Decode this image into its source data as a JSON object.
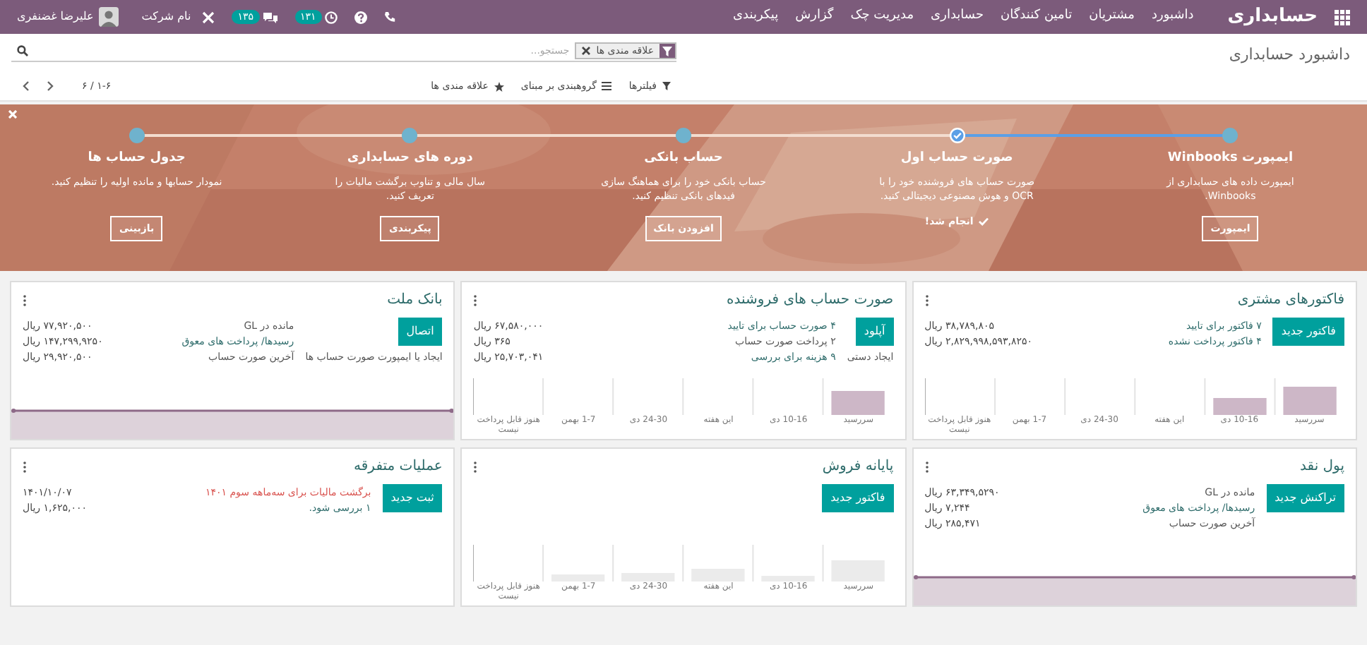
{
  "navbar": {
    "app_title": "حسابداری",
    "menu": [
      "داشبورد",
      "مشتریان",
      "تامین کنندگان",
      "حسابداری",
      "مدیریت چک",
      "گزارش",
      "پیکربندی"
    ],
    "activity_count": "۱۳۱",
    "message_count": "۱۳۵",
    "company": "نام شرکت",
    "user": "علیرضا غضنفری"
  },
  "control_panel": {
    "breadcrumb": "داشبورد حسابداری",
    "search": {
      "facet": "علاقه مندی ها",
      "placeholder": "جستجو..."
    },
    "filters": "فیلترها",
    "group_by": "گروهبندی بر مبنای",
    "favorites": "علاقه مندی ها",
    "pager": "۱-۶ / ۶"
  },
  "onboarding": {
    "steps": [
      {
        "title": "ایمپورت Winbooks",
        "description": "ایمپورت داده های حسابداری از Winbooks.",
        "done": false,
        "button": "ایمپورت"
      },
      {
        "title": "صورت حساب اول",
        "description": "صورت حساب های فروشنده خود را با OCR و هوش مصنوعی دیجیتالی کنید.",
        "done": true,
        "done_label": "انجام شد!"
      },
      {
        "title": "حساب بانکی",
        "description": "حساب بانکی خود را برای هماهنگ سازی فیدهای بانکی تنظیم کنید.",
        "done": false,
        "button": "افزودن بانک"
      },
      {
        "title": "دوره های حسابداری",
        "description": "سال مالی و تناوب برگشت مالیات را تعریف کنید.",
        "done": false,
        "button": "پیکربندی"
      },
      {
        "title": "جدول حساب ها",
        "description": "نمودار حسابها و مانده اولیه را تنظیم کنید.",
        "done": false,
        "button": "بازبینی"
      }
    ]
  },
  "journals": [
    {
      "title": "فاکتورهای مشتری",
      "button": "فاکتور جدید",
      "rows": [
        {
          "kind": "link",
          "label": "۷ فاکتور برای تایید",
          "value": "۳۸,۷۸۹,۸۰۵ ریال"
        },
        {
          "kind": "link",
          "label": "۴ فاکتور پرداخت نشده",
          "value": "۲,۸۲۹,۹۹۸,۵۹۳,۸۲۵۰ ریال"
        }
      ],
      "chart": {
        "kind": "bars",
        "color": "#cdb7c7",
        "labels": [
          "سررسید",
          "10-16 دی",
          "این هفته",
          "24-30 دی",
          "1-7 بهمن",
          "هنوز قابل پرداخت نیست"
        ]
      }
    },
    {
      "title": "صورت حساب های فروشنده",
      "button": "آپلود",
      "link": "ایجاد دستی",
      "rows": [
        {
          "kind": "link",
          "label": "۴ صورت حساب برای تایید",
          "value": "۶۷,۵۸۰,۰۰۰ ریال"
        },
        {
          "kind": "text",
          "label": "۲ پرداخت صورت حساب",
          "value": "۳۶۵ ریال"
        },
        {
          "kind": "link",
          "label": "۹ هزینه برای بررسی",
          "value": "۲۵,۷۰۳,۰۴۱ ریال"
        }
      ],
      "chart": {
        "kind": "bars",
        "color": "#cdb7c7",
        "labels": [
          "سررسید",
          "10-16 دی",
          "این هفته",
          "24-30 دی",
          "1-7 بهمن",
          "هنوز قابل پرداخت نیست"
        ]
      }
    },
    {
      "title": "بانک ملت",
      "button": "اتصال",
      "link": "ایجاد یا ایمپورت صورت حساب ها",
      "rows": [
        {
          "kind": "text",
          "label": "مانده در GL",
          "value": "۷۷,۹۲۰,۵۰۰ ریال"
        },
        {
          "kind": "link",
          "label": "رسیدها/ پرداخت های معوق",
          "value": "۱۴۷,۲۹۹,۹۲۵۰ ریال"
        },
        {
          "kind": "text",
          "label": "آخرین صورت حساب",
          "value": "۲۹,۹۲۰,۵۰۰ ریال"
        }
      ],
      "chart": {
        "kind": "area"
      }
    },
    {
      "title": "پول نقد",
      "button": "تراکنش جدید",
      "rows": [
        {
          "kind": "text",
          "label": "مانده در GL",
          "value": "۶۳,۳۴۹,۵۲۹۰ ریال"
        },
        {
          "kind": "link",
          "label": "رسیدها/ پرداخت های معوق",
          "value": "۷,۲۴۴ ریال"
        },
        {
          "kind": "text",
          "label": "آخرین صورت حساب",
          "value": "۲۸۵,۴۷۱ ریال"
        }
      ],
      "chart": {
        "kind": "area"
      }
    },
    {
      "title": "پایانه فروش",
      "button": "فاکتور جدید",
      "chart": {
        "kind": "bars",
        "color": "#ebebeb",
        "labels": [
          "سررسید",
          "10-16 دی",
          "این هفته",
          "24-30 دی",
          "1-7 بهمن",
          "هنوز قابل پرداخت نیست"
        ]
      }
    },
    {
      "title": "عملیات متفرقه",
      "button": "ثبت جدید",
      "rows": [
        {
          "kind": "alert",
          "label": "برگشت مالیات برای سه‌ماهه سوم ۱۴۰۱",
          "value": "۱۴۰۱/۱۰/۰۷"
        },
        {
          "kind": "link",
          "label": "۱ بررسی شود.",
          "value": "۱,۶۲۵,۰۰۰ ریال"
        }
      ]
    }
  ]
}
